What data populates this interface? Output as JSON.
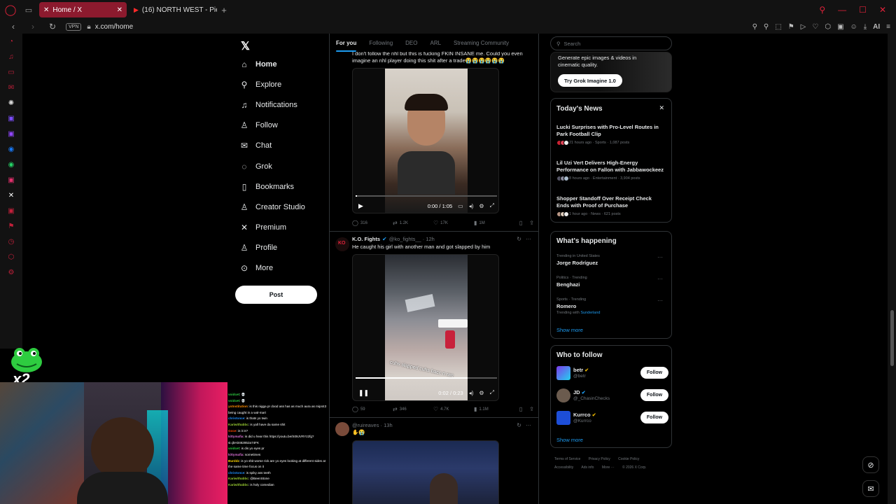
{
  "browser": {
    "tabs": [
      {
        "title": "Home / X",
        "active": true
      },
      {
        "title": "(16) NORTH WEST - Pierci",
        "active": false
      }
    ],
    "url": "x.com/home",
    "vpn": "VPN",
    "ai": "AI"
  },
  "nav": {
    "items": [
      {
        "label": "Home",
        "icon": "home-icon",
        "glyph": "⌂"
      },
      {
        "label": "Explore",
        "icon": "search-icon",
        "glyph": "⚲"
      },
      {
        "label": "Notifications",
        "icon": "bell-icon",
        "glyph": "🔔︎"
      },
      {
        "label": "Follow",
        "icon": "person-plus-icon",
        "glyph": "⚇"
      },
      {
        "label": "Chat",
        "icon": "mail-icon",
        "glyph": "✉"
      },
      {
        "label": "Grok",
        "icon": "grok-icon",
        "glyph": "◌"
      },
      {
        "label": "Bookmarks",
        "icon": "bookmark-icon",
        "glyph": "▯"
      },
      {
        "label": "Creator Studio",
        "icon": "creator-icon",
        "glyph": "♙"
      },
      {
        "label": "Premium",
        "icon": "x-icon",
        "glyph": "✕"
      },
      {
        "label": "Profile",
        "icon": "profile-icon",
        "glyph": "♙"
      },
      {
        "label": "More",
        "icon": "more-icon",
        "glyph": "⋯"
      }
    ],
    "post_label": "Post"
  },
  "feed": {
    "tabs": [
      "For you",
      "Following",
      "DEO",
      "ARL",
      "Streaming Community"
    ],
    "tweet1": {
      "text": "I don't follow the nhl but this is fucking FKIN INSANE me. Could you even imagine an nhl player doing this shit after a trade😭😭😭😭😭😭",
      "time": "0:00 / 1:05",
      "replies": "316",
      "reposts": "1.2K",
      "likes": "17K",
      "views": "1M"
    },
    "tweet2": {
      "name": "K.O. Fights",
      "handle": "@ko_fights__ · 12h",
      "text": "He caught his girl with another man and got slapped by him",
      "caption": "cuhs slapped cuhs bacc n ran",
      "time": "0:02 / 0:23",
      "replies": "59",
      "reposts": "346",
      "likes": "4.7K",
      "views": "1.1M"
    },
    "tweet3": {
      "handle": "@ruireaves · 13h",
      "text": "✋😭"
    }
  },
  "right": {
    "search_placeholder": "Search",
    "grok": {
      "text": "Generate epic images & videos in cinematic quality.",
      "button": "Try Grok Imagine 1.0"
    },
    "news": {
      "title": "Today's News",
      "items": [
        {
          "title": "Lucki Surprises with Pro-Level Routes in Park Football Clip",
          "meta": "21 hours ago · Sports · 1,087 posts"
        },
        {
          "title": "Lil Uzi Vert Delivers High-Energy Performance on Fallon with Jabbawockeez",
          "meta": "8 hours ago · Entertainment · 3,904 posts"
        },
        {
          "title": "Shopper Standoff Over Receipt Check Ends with Proof of Purchase",
          "meta": "1 hour ago · News · 621 posts"
        }
      ]
    },
    "happening": {
      "title": "What's happening",
      "items": [
        {
          "meta": "Trending in United States",
          "name": "Jorge Rodríguez",
          "sub": "",
          "sublink": ""
        },
        {
          "meta": "Politics · Trending",
          "name": "Benghazi",
          "sub": "",
          "sublink": ""
        },
        {
          "meta": "Sports · Trending",
          "name": "Romero",
          "sub": "Trending with",
          "sublink": "Sunderland"
        }
      ],
      "show_more": "Show more"
    },
    "wtf": {
      "title": "Who to follow",
      "items": [
        {
          "name": "betr",
          "handle": "@betr"
        },
        {
          "name": "JD",
          "handle": "@_ChasinChecks"
        },
        {
          "name": "Kurrco",
          "handle": "@Kurrco"
        }
      ],
      "follow_label": "Follow",
      "show_more": "Show more"
    },
    "footer": [
      "Terms of Service",
      "Privacy Policy",
      "Cookie Policy",
      "Accessibility",
      "Ads info",
      "More ···",
      "© 2026 X Corp."
    ]
  },
  "overlay": {
    "multiplier": "x2",
    "chat": [
      {
        "user": "voidcet",
        "msg": ": 💀"
      },
      {
        "user": "voidcet",
        "msg": ": 💀"
      },
      {
        "user": "yotnstitution",
        "msg": ": is this nigga pr dood ass has as much aura as mip443 being caught in a wal-mart"
      },
      {
        "user": "christonce",
        "msg": ": is thats yo twin"
      },
      {
        "user": "Kariwithabbc",
        "msg": ": is yall have da same shit"
      },
      {
        "user": "Goce",
        "msg": ": is it is?"
      },
      {
        "user": "kittymafia",
        "msg": ": is did u hear this https://youtu.be/S09JVRYz2fg?si=jkH3462852a74FK"
      },
      {
        "user": "voidcet",
        "msg": ": is dis yo eyes pr"
      },
      {
        "user": "kittymafia",
        "msg": ": sometimes"
      },
      {
        "user": "Burddz",
        "msg": ": is yo shit worse rick are yo eyes looking at different sides at the same time focus on it"
      },
      {
        "user": "christonce",
        "msg": ": is spiky ass teeth"
      },
      {
        "user": "Kariwithabbc",
        "msg": ": @BeenStone"
      },
      {
        "user": "Kariwithabbc",
        "msg": ": is holy comedian"
      }
    ]
  },
  "colors": {
    "accent": "#1d9bf0",
    "opera_red": "#e0223a",
    "tab_active": "#8c1a2e"
  }
}
